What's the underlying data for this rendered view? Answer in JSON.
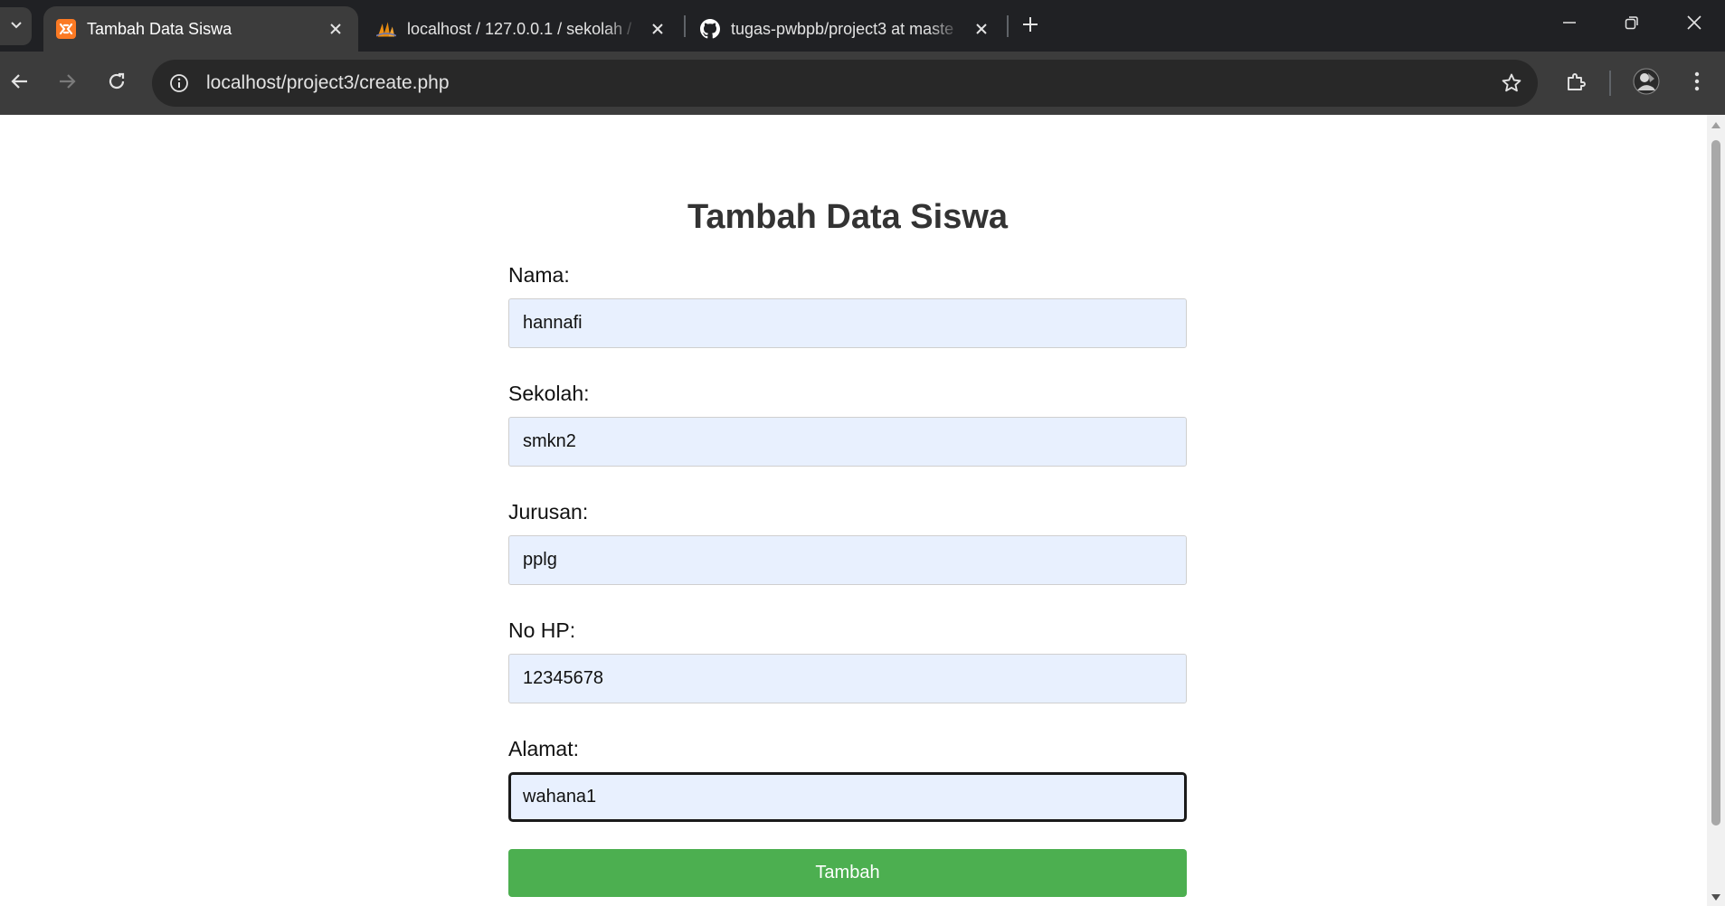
{
  "browser": {
    "tabs": [
      {
        "title": "Tambah Data Siswa",
        "favicon": "xampp-icon",
        "active": true
      },
      {
        "title": "localhost / 127.0.0.1 / sekolah /",
        "favicon": "phpmyadmin-icon",
        "active": false
      },
      {
        "title": "tugas-pwbpb/project3 at maste",
        "favicon": "github-icon",
        "active": false
      }
    ],
    "address": "localhost/project3/create.php"
  },
  "page": {
    "title": "Tambah Data Siswa",
    "fields": [
      {
        "label": "Nama:",
        "value": "hannafi"
      },
      {
        "label": "Sekolah:",
        "value": "smkn2"
      },
      {
        "label": "Jurusan:",
        "value": "pplg"
      },
      {
        "label": "No HP:",
        "value": "12345678"
      },
      {
        "label": "Alamat:",
        "value": "wahana1"
      }
    ],
    "submit_label": "Tambah"
  },
  "colors": {
    "chrome_dark": "#202124",
    "toolbar": "#3c3c3c",
    "input_bg": "#e8f0fe",
    "button_green": "#4caf50",
    "title_text": "#333333"
  }
}
